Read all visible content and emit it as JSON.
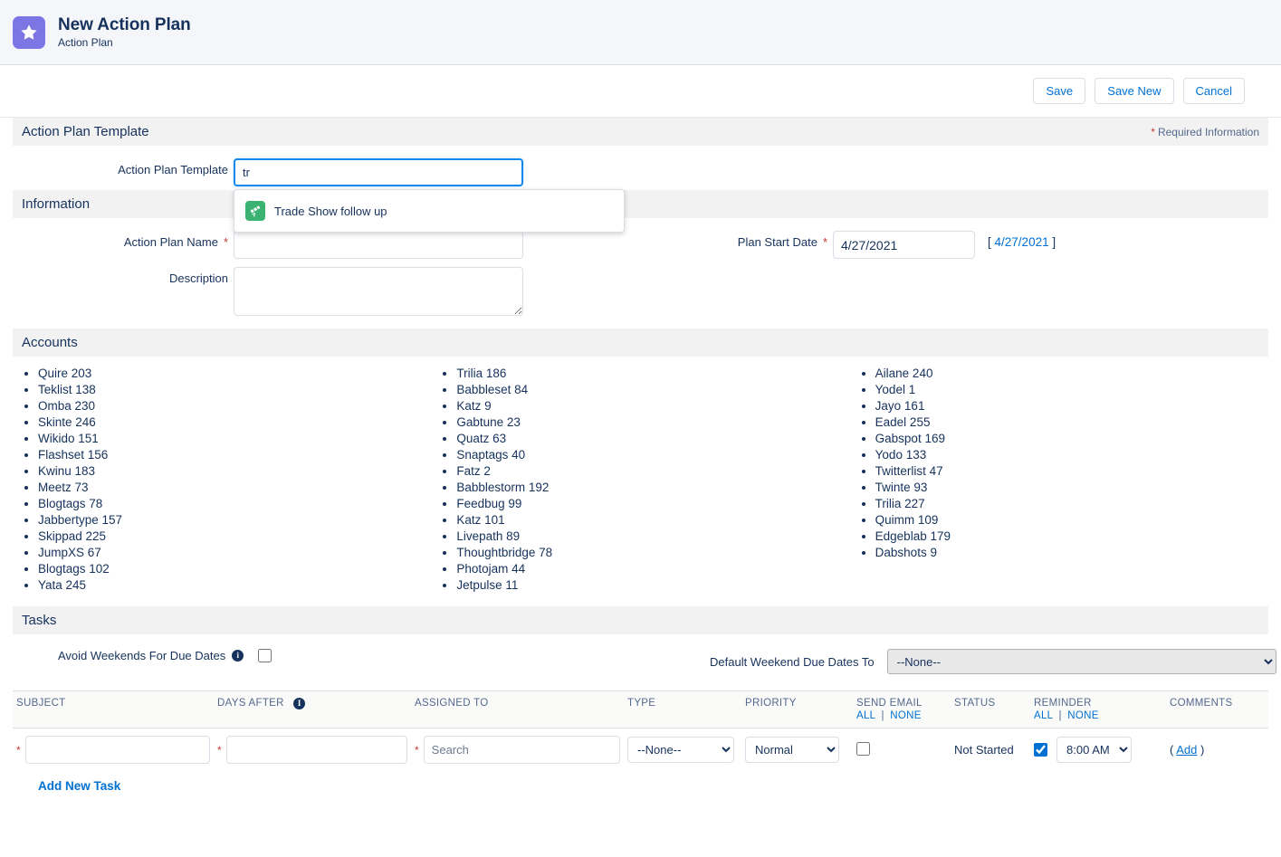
{
  "header": {
    "title": "New Action Plan",
    "subtitle": "Action Plan",
    "icon": "star-icon"
  },
  "actions": {
    "save_label": "Save",
    "save_new_label": "Save New",
    "cancel_label": "Cancel"
  },
  "template_section": {
    "title": "Action Plan Template",
    "required_note": "Required Information",
    "field_label": "Action Plan Template",
    "field_value": "tr",
    "dropdown": {
      "items": [
        {
          "label": "Trade Show follow up",
          "icon": "telescope-icon",
          "icon_color": "#3bb271"
        }
      ]
    }
  },
  "information_section": {
    "title": "Information",
    "name_label": "Action Plan Name",
    "name_value": "",
    "description_label": "Description",
    "description_value": "",
    "start_date_label": "Plan Start Date",
    "start_date_value": "4/27/2021",
    "start_date_link_open": "[",
    "start_date_link": "4/27/2021",
    "start_date_link_close": "]"
  },
  "accounts_section": {
    "title": "Accounts",
    "columns": [
      [
        "Quire 203",
        "Teklist 138",
        "Omba 230",
        "Skinte 246",
        "Wikido 151",
        "Flashset 156",
        "Kwinu 183",
        "Meetz 73",
        "Blogtags 78",
        "Jabbertype 157",
        "Skippad 225",
        "JumpXS 67",
        "Blogtags 102",
        "Yata 245"
      ],
      [
        "Trilia 186",
        "Babbleset 84",
        "Katz 9",
        "Gabtune 23",
        "Quatz 63",
        "Snaptags 40",
        "Fatz 2",
        "Babblestorm 192",
        "Feedbug 99",
        "Katz 101",
        "Livepath 89",
        "Thoughtbridge 78",
        "Photojam 44",
        "Jetpulse 11"
      ],
      [
        "Ailane 240",
        "Yodel 1",
        "Jayo 161",
        "Eadel 255",
        "Gabspot 169",
        "Yodo 133",
        "Twitterlist 47",
        "Twinte 93",
        "Trilia 227",
        "Quimm 109",
        "Edgeblab 179",
        "Dabshots 9"
      ]
    ]
  },
  "tasks_section": {
    "title": "Tasks",
    "avoid_weekends_label": "Avoid Weekends For Due Dates",
    "avoid_weekends_info": "i",
    "avoid_weekends_checked": false,
    "default_weekend_label": "Default Weekend Due Dates To",
    "default_weekend_value": "--None--",
    "default_weekend_options": [
      "--None--"
    ],
    "table": {
      "headers": {
        "subject": "SUBJECT",
        "days_after": "DAYS AFTER",
        "days_after_info": "i",
        "assigned_to": "ASSIGNED TO",
        "type": "TYPE",
        "priority": "PRIORITY",
        "send_email": "SEND EMAIL",
        "status": "STATUS",
        "reminder": "REMINDER",
        "comments": "COMMENTS",
        "all_label": "ALL",
        "none_label": "NONE",
        "separator": "|"
      },
      "rows": [
        {
          "subject_value": "",
          "days_after_value": "",
          "assigned_to_placeholder": "Search",
          "assigned_to_value": "",
          "type_value": "--None--",
          "type_options": [
            "--None--"
          ],
          "priority_value": "Normal",
          "priority_options": [
            "Normal"
          ],
          "send_email_checked": false,
          "status_value": "Not Started",
          "reminder_checked": true,
          "reminder_time_value": "8:00 AM",
          "reminder_time_options": [
            "8:00 AM"
          ],
          "comments_open": "(",
          "comments_add": "Add",
          "comments_close": ")"
        }
      ]
    },
    "add_new_task_label": "Add New Task"
  }
}
